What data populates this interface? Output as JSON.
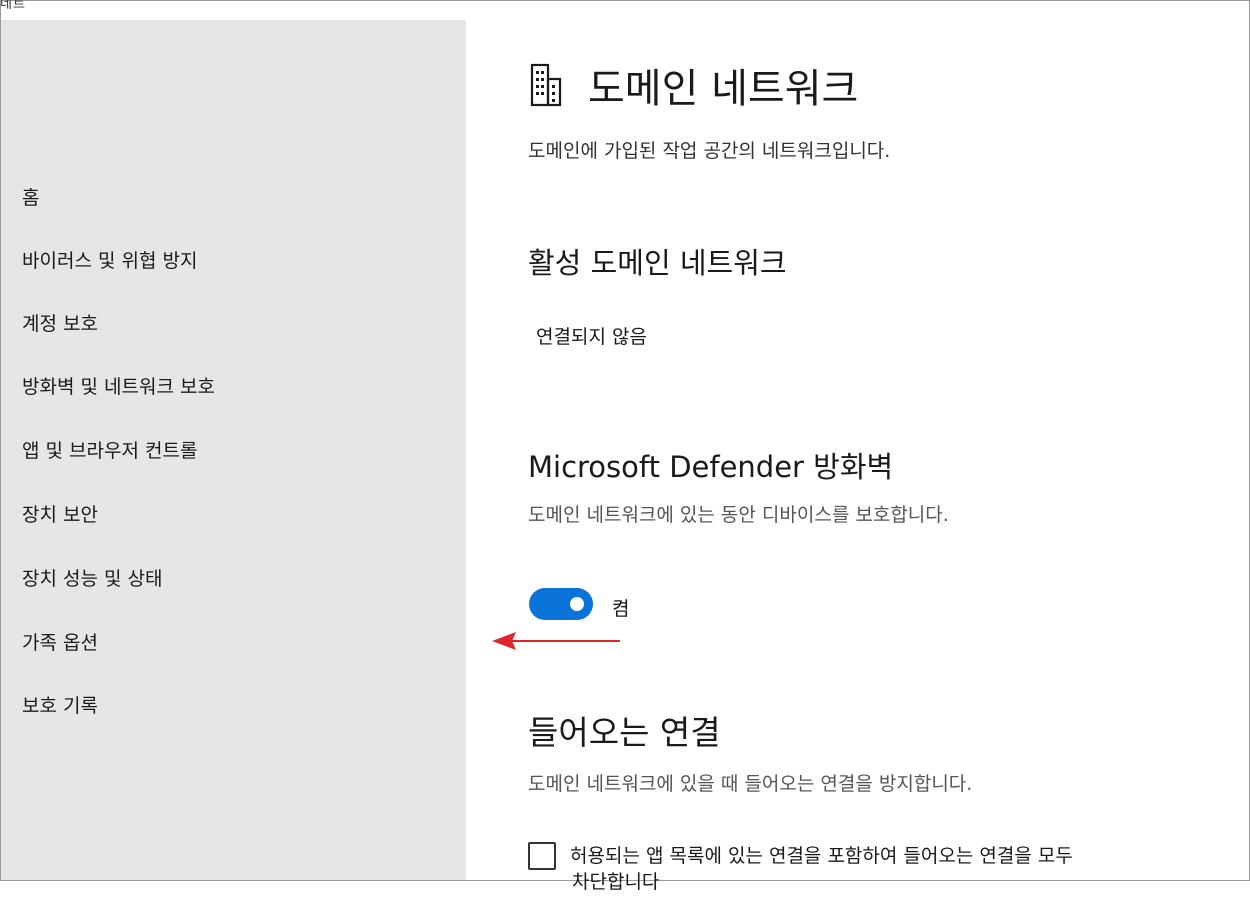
{
  "window": {
    "title_fragment": "네트"
  },
  "sidebar": {
    "items": [
      {
        "label": "홈"
      },
      {
        "label": "바이러스 및 위협 방지"
      },
      {
        "label": "계정 보호"
      },
      {
        "label": "방화벽 및 네트워크 보호"
      },
      {
        "label": "앱 및 브라우저 컨트롤"
      },
      {
        "label": "장치 보안"
      },
      {
        "label": "장치 성능 및 상태"
      },
      {
        "label": "가족 옵션"
      },
      {
        "label": "보호 기록"
      }
    ]
  },
  "main": {
    "icon": "building-icon",
    "title": "도메인 네트워크",
    "description": "도메인에 가입된 작업 공간의 네트워크입니다.",
    "active_network": {
      "heading": "활성 도메인 네트워크",
      "status": "연결되지 않음"
    },
    "firewall": {
      "heading": "Microsoft Defender 방화벽",
      "description": "도메인 네트워크에 있는 동안 디바이스를 보호합니다.",
      "toggle_state": "켬",
      "toggle_on": true
    },
    "incoming": {
      "heading": "들어오는 연결",
      "description": "도메인 네트워크에 있을 때 들어오는 연결을 방지합니다.",
      "checkbox_label": "허용되는 앱 목록에 있는 연결을 포함하여 들어오는 연결을 모두",
      "checkbox_label_continued": "차단합니다",
      "checked": false
    }
  },
  "colors": {
    "accent": "#0a73d9",
    "sidebar_bg": "#e6e6e6",
    "annotation_arrow": "#e0252b"
  }
}
